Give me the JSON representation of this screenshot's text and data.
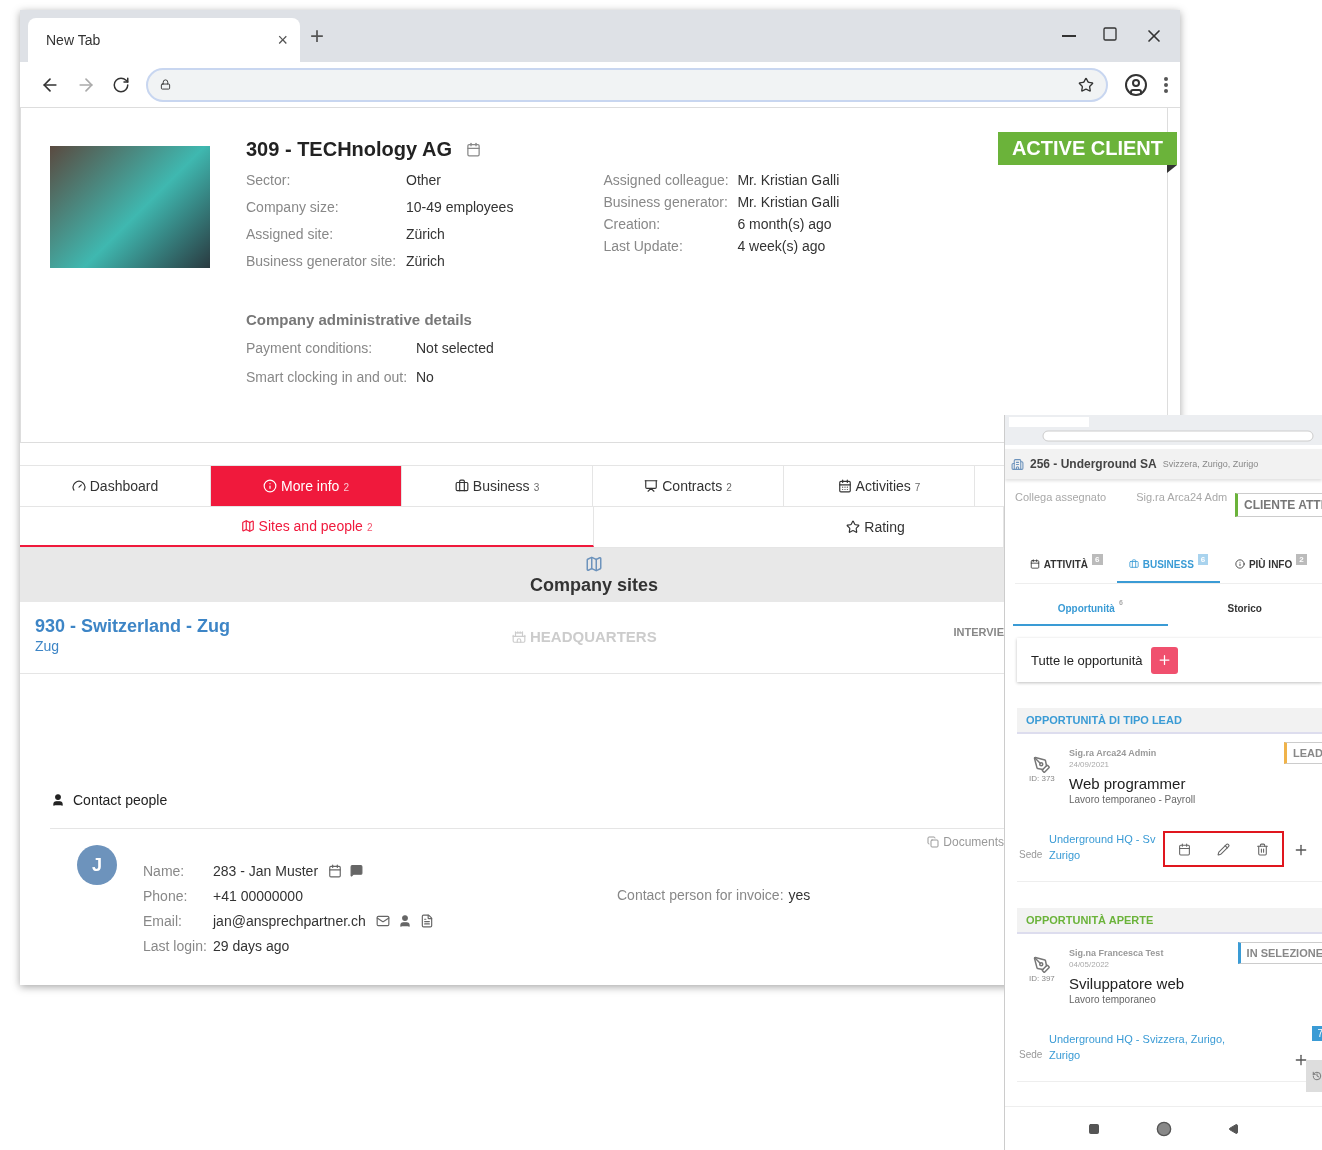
{
  "browser": {
    "tab_title": "New Tab",
    "tab_close": "×",
    "new_tab": "+"
  },
  "company": {
    "title": "309 - TECHnology AG",
    "status": "ACTIVE CLIENT",
    "details_left": [
      {
        "label": "Sector:",
        "value": "Other"
      },
      {
        "label": "Company size:",
        "value": "10-49 employees"
      },
      {
        "label": "Assigned site:",
        "value": "Zürich"
      },
      {
        "label": "Business generator site:",
        "value": "Zürich"
      }
    ],
    "details_right": [
      {
        "label": "Assigned colleague:",
        "value": "Mr. Kristian Galli"
      },
      {
        "label": "Business generator:",
        "value": "Mr. Kristian Galli"
      },
      {
        "label": "Creation:",
        "value": "6 month(s) ago"
      },
      {
        "label": "Last Update:",
        "value": "4 week(s) ago"
      }
    ],
    "admin_title": "Company administrative details",
    "admin_details": [
      {
        "label": "Payment conditions:",
        "value": "Not selected"
      },
      {
        "label": "Smart clocking in and out:",
        "value": "No"
      }
    ]
  },
  "tabs": [
    {
      "label": "Dashboard",
      "selected": false
    },
    {
      "label": "More info",
      "count": "2",
      "selected": true
    },
    {
      "label": "Business",
      "count": "3",
      "selected": false
    },
    {
      "label": "Contracts",
      "count": "2",
      "selected": false
    },
    {
      "label": "Activities",
      "count": "7",
      "selected": false
    }
  ],
  "subtabs": [
    {
      "label": "Sites and people",
      "count": "2",
      "selected": true
    },
    {
      "label": "Rating",
      "selected": false
    }
  ],
  "sites_section": {
    "title": "Company sites",
    "sites": [
      {
        "name": "930 - Switzerland - Zug",
        "city": "Zug",
        "type": "HEADQUARTERS",
        "column_3": "INTERVIE"
      }
    ]
  },
  "contacts": {
    "title": "Contact people",
    "documents": "Documents",
    "people": [
      {
        "initial": "J",
        "fields": [
          {
            "label": "Name:",
            "value": "283 - Jan Muster"
          },
          {
            "label": "Phone:",
            "value": "+41 00000000"
          },
          {
            "label": "Email:",
            "value": "jan@ansprechpartner.ch"
          },
          {
            "label": "Last login:",
            "value": "29 days ago"
          }
        ],
        "invoice_label": "Contact person for invoice:",
        "invoice_value": "yes"
      }
    ]
  },
  "mobile": {
    "title": "256 - Underground SA",
    "subtitle": "Svizzera, Zurigo, Zurigo",
    "faded_label": "Collega assegnato",
    "faded_value": "Sig.ra Arca24 Adm",
    "status": "CLIENTE ATTI",
    "tabs": [
      {
        "label": "ATTIVITÀ",
        "count": "6",
        "selected": false
      },
      {
        "label": "BUSINESS",
        "count": "6",
        "selected": true
      },
      {
        "label": "PIÙ INFO",
        "count": "2",
        "selected": false
      }
    ],
    "subtabs": [
      {
        "label": "Opportunità",
        "count": "6",
        "selected": true
      },
      {
        "label": "Storico",
        "selected": false
      }
    ],
    "all_label": "Tutte le opportunità",
    "sections": [
      {
        "title": "OPPORTUNITÀ DI TIPO LEAD",
        "color": "#3a9bd5",
        "items": [
          {
            "author": "Sig.ra Arca24 Admin",
            "date": "24/09/2021",
            "id": "ID: 373",
            "title": "Web programmer",
            "subtitle": "Lavoro temporaneo - Payroll",
            "status": "LEAD",
            "color": "#f0b34a",
            "site_label": "Sede",
            "site_line1": "Underground HQ - Sv",
            "site_line2": "Zurigo",
            "highlighted": true
          }
        ]
      },
      {
        "title": "OPPORTUNITÀ APERTE",
        "color": "#6bb33a",
        "items": [
          {
            "author": "Sig.na Francesca Test",
            "date": "04/05/2022",
            "id": "ID: 397",
            "title": "Sviluppatore web",
            "subtitle": "Lavoro temporaneo",
            "status": "IN SELEZIONE",
            "color": "#3a9bd5",
            "site_label": "Sede",
            "site_line1": "Underground HQ - Svizzera, Zurigo,",
            "site_line2": "Zurigo",
            "badge": "7",
            "highlighted": false
          }
        ]
      }
    ]
  }
}
